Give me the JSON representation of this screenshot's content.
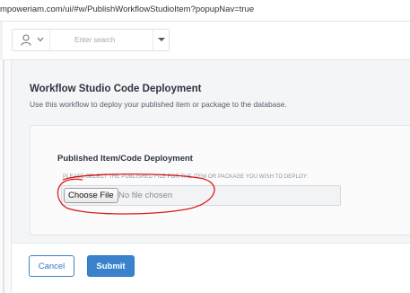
{
  "browser": {
    "address_url": "mpoweriam.com/ui/#w/PublishWorkflowStudioItem?popupNav=true"
  },
  "header": {
    "user_icon": "user-icon",
    "search": {
      "placeholder": "Enter search",
      "value": ""
    }
  },
  "page": {
    "title": "Workflow Studio Code Deployment",
    "description": "Use this workflow to deploy your published item or package to the database."
  },
  "card": {
    "title": "Published Item/Code Deployment",
    "file_field": {
      "label": "PLEASE SELECT THE PUBLISHED FILE FOR THE ITEM OR PACKAGE YOU WISH TO DEPLOY:",
      "button_label": "Choose File",
      "status_text": "No file chosen"
    },
    "annotation_color": "#d81b1b"
  },
  "footer": {
    "cancel_label": "Cancel",
    "submit_label": "Submit"
  },
  "colors": {
    "accent": "#3a83cc",
    "page_background": "#f4f5f7"
  }
}
